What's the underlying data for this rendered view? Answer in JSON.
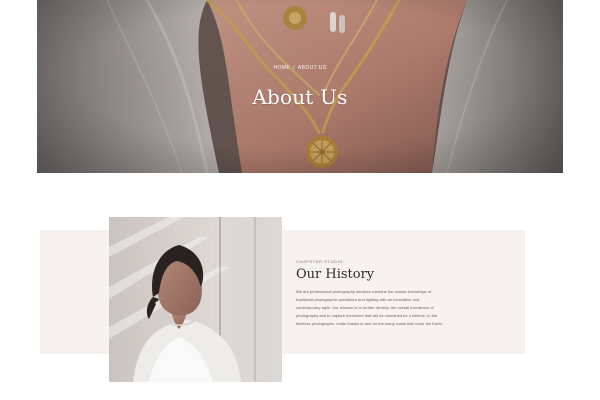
{
  "hero": {
    "breadcrumb": {
      "home": "HOME",
      "separator": "/",
      "current": "ABOUT US"
    },
    "title": "About Us"
  },
  "history": {
    "kicker": "CHAPSTER STUDIO",
    "title": "Our History",
    "paragraph_lines": [
      "We are professional photography services combine the classic knowledge of",
      "traditional photographic portraiture and lighting with an innovative and",
      "contemporary style. Our mission is to further develop the overall excellence of",
      "photography and to capture memories that will be cherished for a lifetime, to the",
      "timeless photographs, made thanks to and for the many roads that cover the Earth."
    ]
  },
  "colors": {
    "band_background": "#f7f2ef",
    "title_text": "#2f2a28",
    "body_text": "#6c6461"
  }
}
